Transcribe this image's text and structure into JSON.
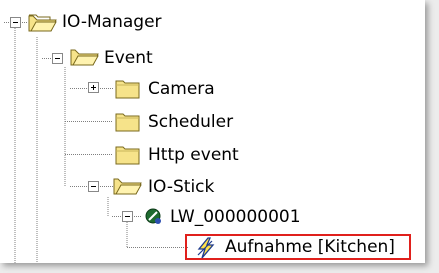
{
  "tree": {
    "root": {
      "label": "IO-Manager",
      "expanded": true
    },
    "event": {
      "label": "Event",
      "expanded": true
    },
    "camera": {
      "label": "Camera",
      "expanded": false
    },
    "scheduler": {
      "label": "Scheduler"
    },
    "http_event": {
      "label": "Http event"
    },
    "io_stick": {
      "label": "IO-Stick",
      "expanded": true
    },
    "device": {
      "label": "LW_000000001",
      "expanded": true
    },
    "action": {
      "label": "Aufnahme [Kitchen]",
      "selected": true
    }
  },
  "colors": {
    "folder_fill": "#f6e38a",
    "folder_stroke": "#7a6a1e",
    "selection_border": "#e0201c",
    "lightning": "#1e3b8c",
    "device_icon": "#1e6a2f"
  },
  "icons": {
    "folder": "folder-icon",
    "folder_open": "folder-open-icon",
    "device": "device-icon",
    "action": "lightning-icon"
  }
}
